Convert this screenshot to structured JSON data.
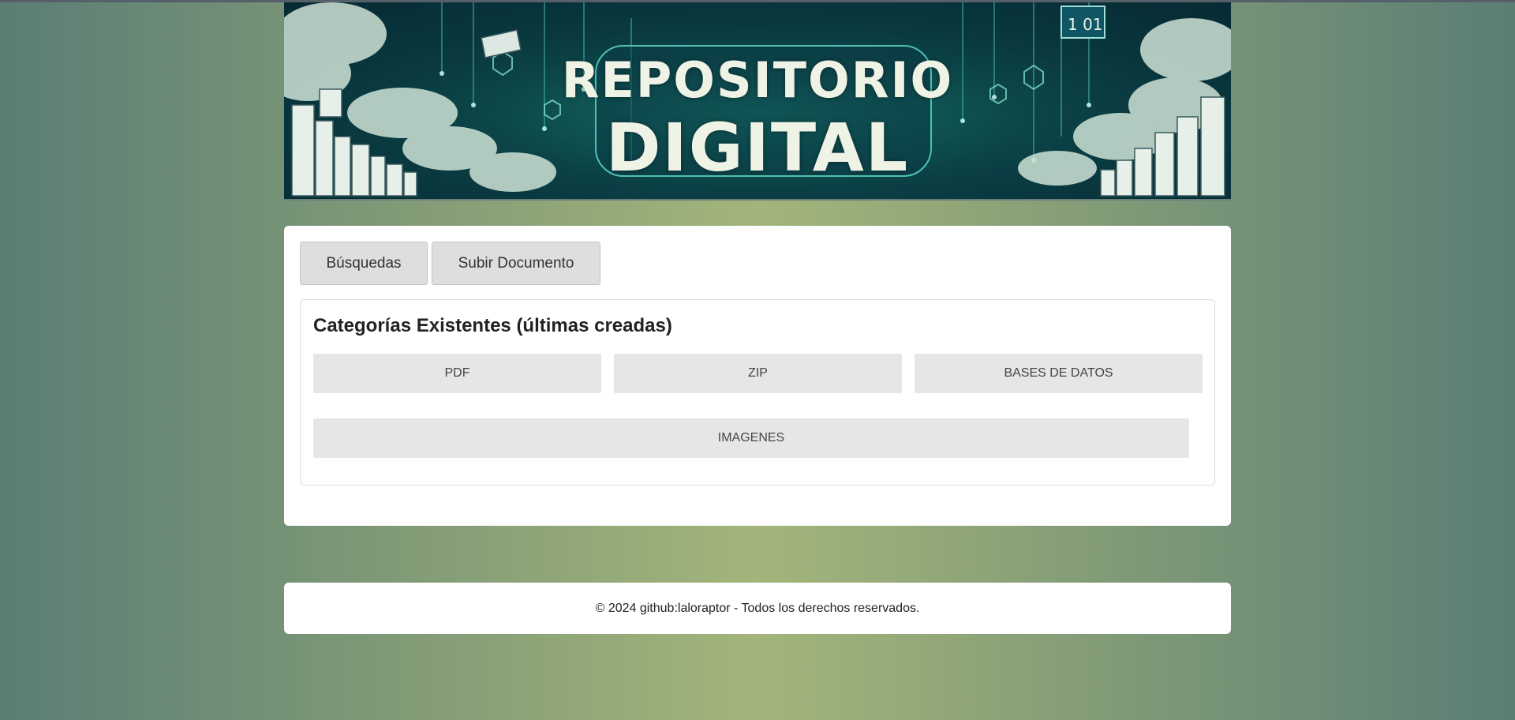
{
  "banner": {
    "line1": "REPOSITORIO",
    "line2": "DIGITAL",
    "badge": "1  01"
  },
  "tabs": [
    {
      "label": "Búsquedas"
    },
    {
      "label": "Subir Documento"
    }
  ],
  "categories": {
    "title": "Categorías Existentes (últimas creadas)",
    "items": [
      {
        "label": "PDF"
      },
      {
        "label": "ZIP"
      },
      {
        "label": "BASES DE DATOS"
      },
      {
        "label": "IMAGENES"
      }
    ]
  },
  "footer": {
    "text": "© 2024 github:laloraptor - Todos los derechos reservados."
  },
  "colors": {
    "background_center": "#a3b57a",
    "background_edge": "#5b7e75",
    "card": "#ffffff",
    "category_button": "#e6e6e6",
    "tab_button": "#dedede"
  }
}
